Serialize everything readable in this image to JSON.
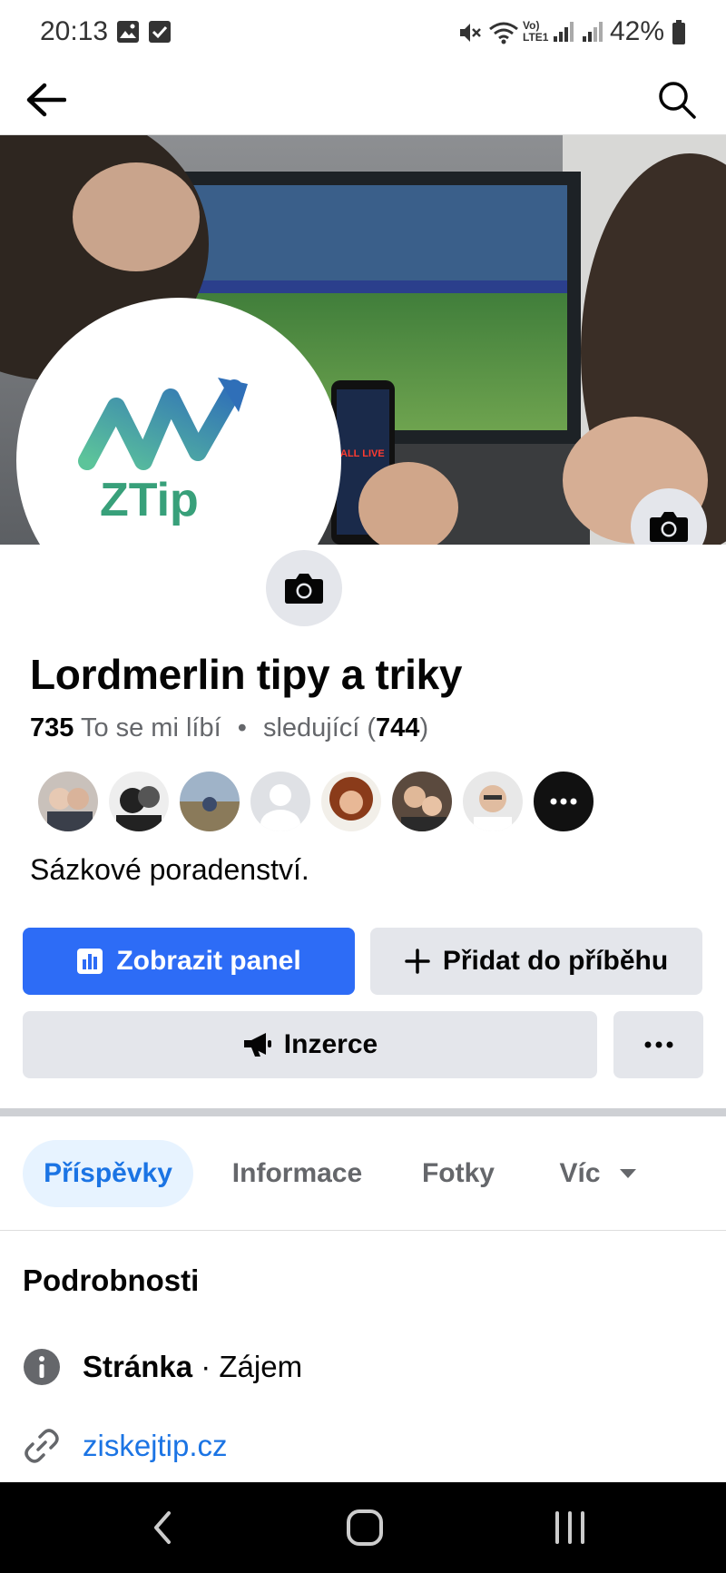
{
  "status_bar": {
    "time": "20:13",
    "battery": "42%"
  },
  "page": {
    "title": "Lordmerlin tipy a triky",
    "likes_count": "735",
    "likes_label": "To se mi líbí",
    "separator": "•",
    "followers_label": "sledující (",
    "followers_count": "744",
    "followers_close": ")",
    "description": "Sázkové poradenství.",
    "logo_text": "ZTip"
  },
  "cover_overlay": {
    "screen_text": "ALL LIVE"
  },
  "actions": {
    "dashboard": "Zobrazit panel",
    "add_story": "Přidat do příběhu",
    "ads": "Inzerce"
  },
  "tabs": [
    "Příspěvky",
    "Informace",
    "Fotky",
    "Víc"
  ],
  "details": {
    "title": "Podrobnosti",
    "category_bold": "Stránka",
    "category_rest": " · Zájem",
    "website": "ziskejtip.cz"
  },
  "colors": {
    "primary": "#2d6cf6",
    "link": "#1b74e4",
    "secondary_bg": "#e4e6eb"
  },
  "friends": [
    "friend-1",
    "friend-2",
    "friend-3",
    "friend-4",
    "friend-5",
    "friend-6",
    "friend-7",
    "more-friends"
  ]
}
